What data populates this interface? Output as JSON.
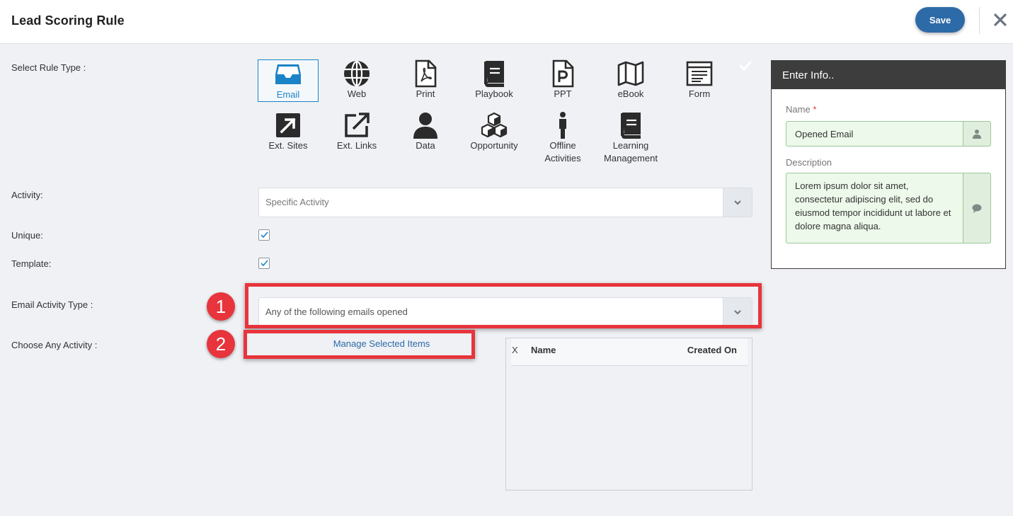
{
  "header": {
    "title": "Lead Scoring Rule",
    "save_label": "Save"
  },
  "labels": {
    "select_rule_type": "Select Rule Type :",
    "activity": "Activity:",
    "unique": "Unique:",
    "template": "Template:",
    "email_activity_type": "Email Activity Type :",
    "choose_any_activity": "Choose Any Activity :"
  },
  "rule_types": [
    {
      "label": "Email",
      "icon": "inbox-icon",
      "selected": true
    },
    {
      "label": "Web",
      "icon": "globe-icon"
    },
    {
      "label": "Print",
      "icon": "pdf-file-icon"
    },
    {
      "label": "Playbook",
      "icon": "book-icon"
    },
    {
      "label": "PPT",
      "icon": "ppt-file-icon"
    },
    {
      "label": "eBook",
      "icon": "map-icon"
    },
    {
      "label": "Form",
      "icon": "form-icon"
    },
    {
      "label": "Ext. Sites",
      "icon": "external-arrow-box-icon"
    },
    {
      "label": "Ext. Links",
      "icon": "external-link-icon"
    },
    {
      "label": "Data",
      "icon": "user-icon"
    },
    {
      "label": "Opportunity",
      "icon": "cubes-icon"
    },
    {
      "label": "Offline Activities",
      "label_line1": "Offline",
      "label_line2": "Activities",
      "icon": "person-standing-icon"
    },
    {
      "label": "Learning Management",
      "label_line1": "Learning",
      "label_line2": "Management",
      "icon": "book-icon"
    }
  ],
  "activity_select": {
    "value": "Specific Activity"
  },
  "unique_checked": true,
  "template_checked": true,
  "email_activity_type_select": {
    "value": "Any of the following emails opened"
  },
  "manage_link": "Manage Selected Items",
  "grid": {
    "columns": [
      "X",
      "Name",
      "Created On"
    ],
    "rows": []
  },
  "annotations": {
    "badge_1": "1",
    "badge_2": "2"
  },
  "info_panel": {
    "title": "Enter Info..",
    "name_label": "Name",
    "required_mark": "*",
    "name_value": "Opened Email",
    "description_label": "Description",
    "description_value": "Lorem ipsum dolor sit amet, consectetur adipiscing elit, sed do eiusmod tempor incididunt ut labore et dolore magna aliqua."
  },
  "colors": {
    "accent": "#1a84c7",
    "save_button": "#2d6aa8",
    "highlight": "#e8343c",
    "panel_header": "#3d3d3d",
    "field_bg": "#edf9ea"
  }
}
